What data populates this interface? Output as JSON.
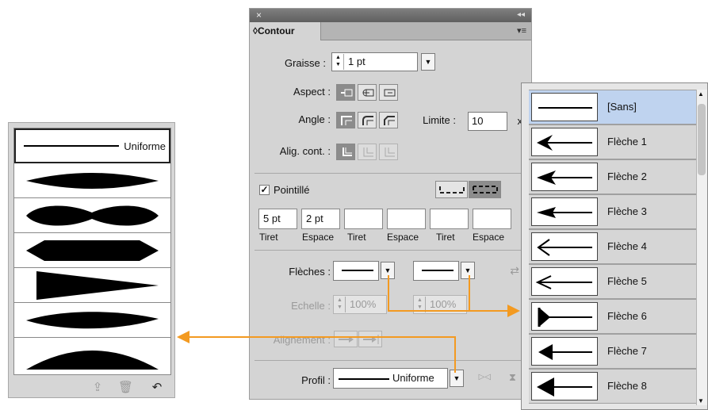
{
  "profile_panel": {
    "selected_label": "Uniforme",
    "footer_icons": [
      "add-profile-icon",
      "delete-profile-icon",
      "reset-profile-icon"
    ]
  },
  "contour_panel": {
    "close_glyph": "×",
    "collapse_glyph": "◂◂",
    "tab_label": "Contour",
    "tab_prefix": "◊",
    "tab_menu_glyph": "▾≡",
    "graisse": {
      "label": "Graisse :",
      "value": "1 pt"
    },
    "aspect": {
      "label": "Aspect :"
    },
    "angle": {
      "label": "Angle :"
    },
    "limite": {
      "label": "Limite :",
      "value": "10",
      "unit": "x"
    },
    "alig_cont": {
      "label": "Alig. cont. :"
    },
    "pointille": {
      "label": "Pointillé",
      "checked_glyph": "✓"
    },
    "dash_fields": [
      {
        "value": "5 pt",
        "caption": "Tiret"
      },
      {
        "value": "2 pt",
        "caption": "Espace"
      },
      {
        "value": "",
        "caption": "Tiret"
      },
      {
        "value": "",
        "caption": "Espace"
      },
      {
        "value": "",
        "caption": "Tiret"
      },
      {
        "value": "",
        "caption": "Espace"
      }
    ],
    "fleches": {
      "label": "Flèches :",
      "dropdown_glyph": "▼",
      "swap_glyph": "⇄"
    },
    "echelle": {
      "label": "Echelle :",
      "start_value": "100%",
      "end_value": "100%"
    },
    "alignement": {
      "label": "Alignement :"
    },
    "profil": {
      "label": "Profil :",
      "value": "Uniforme",
      "flip_h_glyph": "▷◁",
      "flip_v_glyph": "⧗"
    }
  },
  "arrowheads_list": {
    "items": [
      {
        "label": "[Sans]",
        "selected": true
      },
      {
        "label": "Flèche 1",
        "selected": false
      },
      {
        "label": "Flèche 2",
        "selected": false
      },
      {
        "label": "Flèche 3",
        "selected": false
      },
      {
        "label": "Flèche 4",
        "selected": false
      },
      {
        "label": "Flèche 5",
        "selected": false
      },
      {
        "label": "Flèche 6",
        "selected": false
      },
      {
        "label": "Flèche 7",
        "selected": false
      },
      {
        "label": "Flèche 8",
        "selected": false
      }
    ]
  },
  "colors": {
    "connector": "#f39a21",
    "selected_row": "#bfd3ef",
    "panel_bg": "#d4d4d4"
  }
}
